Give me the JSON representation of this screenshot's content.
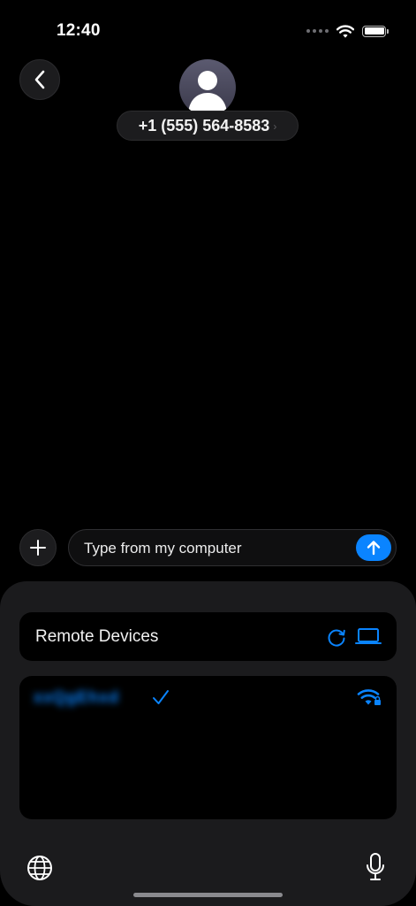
{
  "status": {
    "time": "12:40"
  },
  "contact": {
    "name": "+1 (555) 564-8583",
    "chevron": "›"
  },
  "compose": {
    "message": "Type from my computer"
  },
  "remote": {
    "title": "Remote Devices"
  },
  "devices": [
    {
      "name": "xxQgEhxd",
      "selected": true
    }
  ],
  "icons": {
    "back": "chevron-left-icon",
    "plus": "plus-icon",
    "send": "arrow-up-icon",
    "refresh": "refresh-icon",
    "laptop": "laptop-icon",
    "check": "checkmark-icon",
    "wifi_lock": "wifi-lock-icon",
    "globe": "globe-icon",
    "mic": "microphone-icon"
  },
  "colors": {
    "accent": "#0a84ff",
    "background": "#000000",
    "sheet": "#1b1b1d"
  }
}
